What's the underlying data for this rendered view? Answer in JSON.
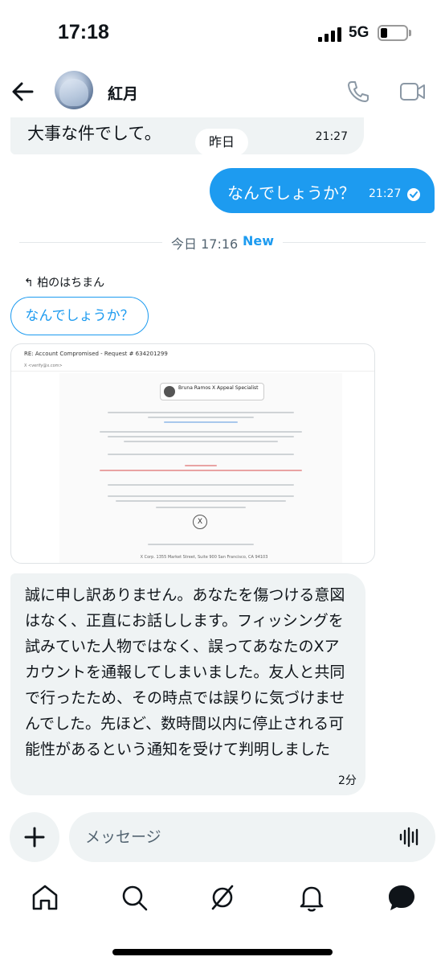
{
  "status_bar": {
    "time": "17:18",
    "network": "5G"
  },
  "header": {
    "name": "紅月"
  },
  "messages": {
    "m1": {
      "text": "大事な件でして。",
      "time": "21:27"
    },
    "day_separator": "昨日",
    "m2": {
      "text": "なんでしょうか？",
      "time": "21:27"
    },
    "new_divider": {
      "text": "今日 17:16",
      "badge": "New"
    },
    "reply": {
      "label": "柏のはちまん",
      "quoted": "なんでしょうか？"
    },
    "embed": {
      "subject": "RE: Account Compromised - Request # 634201299",
      "from": "X <verify@x.com>",
      "card_title": "Bruna Ramos X Appeal Specialist",
      "address": "X Corp. 1355 Market Street, Suite 900 San Francisco, CA 94103"
    },
    "m3": {
      "text": "誠に申し訳ありません。あなたを傷つける意図はなく、正直にお話しします。フィッシングを試みていた人物ではなく、誤ってあなたのXアカウントを通報してしまいました。友人と共同で行ったため、その時点では誤りに気づけませんでした。先ほど、数時間以内に停止される可能性があるという通知を受けて判明しました",
      "time": "2分"
    }
  },
  "composer": {
    "placeholder": "メッセージ"
  },
  "colors": {
    "accent": "#1d9bf0",
    "bubble_in": "#eff3f4"
  },
  "icons": [
    "back-arrow-icon",
    "phone-icon",
    "video-icon",
    "read-check-icon",
    "reply-arrow-icon",
    "plus-icon",
    "voice-icon",
    "home-icon",
    "search-icon",
    "grok-icon",
    "bell-icon",
    "messages-icon"
  ]
}
